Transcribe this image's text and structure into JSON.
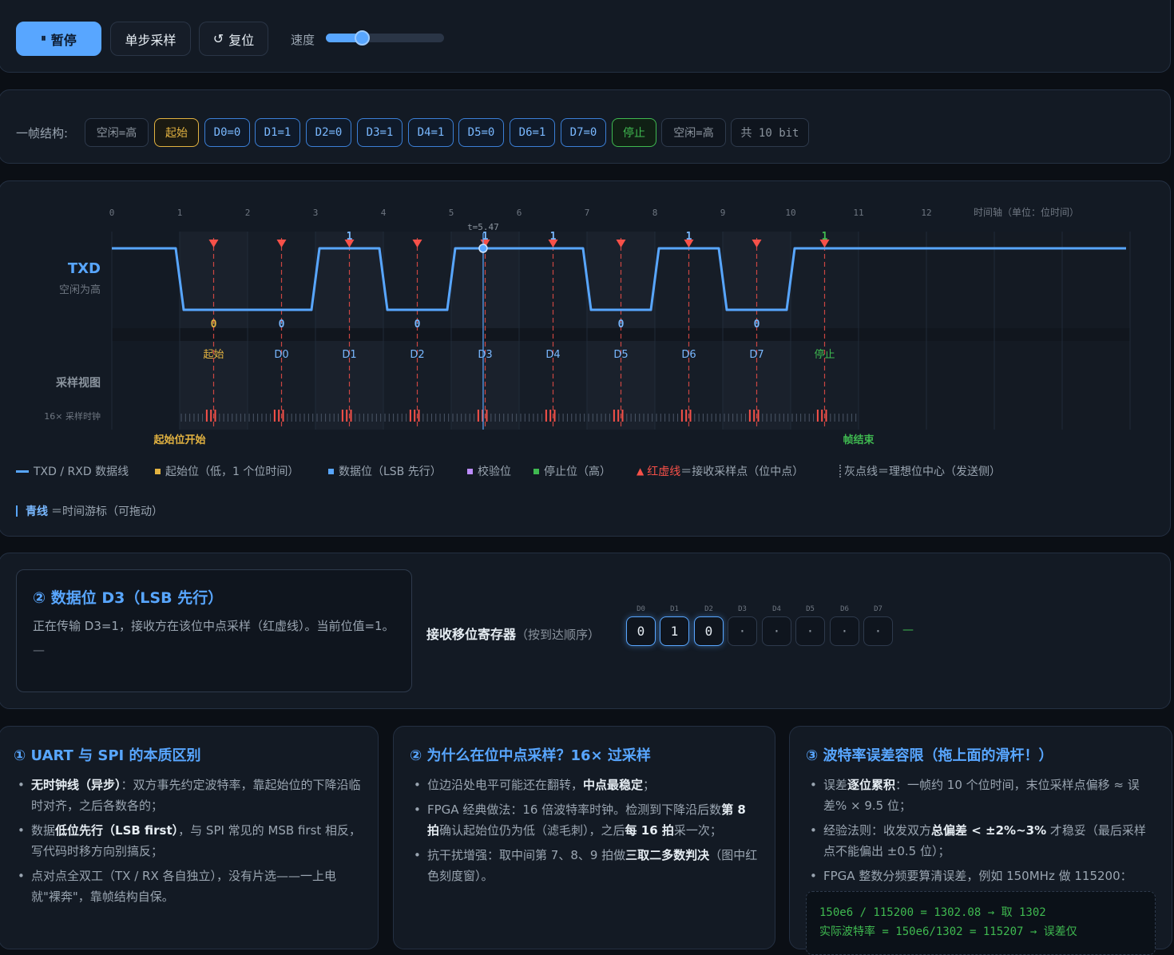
{
  "controls": {
    "pause_icon": "⏸",
    "pause_label": "暂停",
    "step_label": "单步采样",
    "reset_icon": "↺",
    "reset_label": "复位",
    "speed_label": "速度",
    "speed_value_fraction": 0.31
  },
  "frame": {
    "label": "一帧结构:",
    "chips": [
      "空闲=高",
      "起始",
      "D0=0",
      "D1=1",
      "D2=0",
      "D3=1",
      "D4=1",
      "D5=0",
      "D6=1",
      "D7=0",
      "停止",
      "空闲=高",
      "共 10 bit"
    ]
  },
  "waveform": {
    "axis_caption": "时间轴（单位：位时间）",
    "cursor_label": "t=5.47",
    "txd_label": "TXD",
    "txd_sub": "空闲为高",
    "sampling_label": "采样视图",
    "clock_label": "16× 采样时钟",
    "start_marker": "起始位开始",
    "end_marker": "帧结束",
    "bit_names": [
      "起始",
      "D0",
      "D1",
      "D2",
      "D3",
      "D4",
      "D5",
      "D6",
      "D7",
      "停止"
    ],
    "bit_values": [
      "0",
      "0",
      "1",
      "0",
      "1",
      "1",
      "0",
      "1",
      "0",
      "1"
    ],
    "ticks": [
      "0",
      "1",
      "2",
      "3",
      "4",
      "5",
      "6",
      "7",
      "8",
      "9",
      "10",
      "11",
      "12"
    ]
  },
  "legend": {
    "line": "TXD / RXD 数据线",
    "start": "起始位（低，1 个位时间）",
    "data": "数据位（LSB 先行）",
    "parity": "校验位",
    "stop": "停止位（高）",
    "sample_strong": "红虚线",
    "sample_rest": "＝接收采样点（位中点）",
    "ideal": "灰点线＝理想位中心（发送侧）",
    "cursor_strong": "青线",
    "cursor_rest": "＝时间游标（可拖动）"
  },
  "status": {
    "title": "② 数据位 D3（LSB 先行）",
    "text": "正在传输 D3=1，接收方在该位中点采样（红虚线）。当前位值=1。",
    "dash": "—",
    "register_strong": "接收移位寄存器",
    "register_rest": "（按到达顺序）",
    "register_labels": [
      "D0",
      "D1",
      "D2",
      "D3",
      "D4",
      "D5",
      "D6",
      "D7"
    ],
    "register_values": [
      "0",
      "1",
      "0",
      "·",
      "·",
      "·",
      "·",
      "·"
    ],
    "register_tail": "—"
  },
  "info": [
    {
      "title": "① UART 与 SPI 的本质区别",
      "items": [
        [
          "无时钟线（异步）",
          "：双方事先约定波特率，靠起始位的下降沿临时对齐，之后各数各的；"
        ],
        [
          "数据",
          "低位先行（LSB first）",
          "，与 SPI 常见的 MSB first 相反，写代码时移方向别搞反；"
        ],
        [
          "点对点全双工（TX / RX 各自独立），没有片选——一上电就\"裸奔\"，靠帧结构自保。"
        ]
      ]
    },
    {
      "title": "② 为什么在位中点采样？16× 过采样",
      "items": [
        [
          "位边沿处电平可能还在翻转，",
          "中点最稳定",
          "；"
        ],
        [
          "FPGA 经典做法：16 倍波特率时钟。检测到下降沿后数",
          "第 8 拍",
          "确认起始位仍为低（滤毛刺），之后",
          "每 16 拍",
          "采一次；"
        ],
        [
          "抗干扰增强：取中间第 7、8、9 拍做",
          "三取二多数判决",
          "（图中红色刻度窗）。"
        ]
      ]
    },
    {
      "title": "③ 波特率误差容限（拖上面的滑杆！）",
      "items": [
        [
          "误差",
          "逐位累积",
          "：一帧约 10 个位时间，末位采样点偏移 ≈ 误差% × 9.5 位；"
        ],
        [
          "经验法则：收发双方",
          "总偏差 < ±2%~3%",
          " 才稳妥（最后采样点不能偏出 ±0.5 位）；"
        ],
        [
          "FPGA 整数分频要算清误差，例如 150MHz 做 115200："
        ]
      ],
      "code": [
        "150e6 / 115200 = 1302.08 → 取 1302",
        "实际波特率 = 150e6/1302 = 115207 → 误差仅"
      ]
    }
  ],
  "colors": {
    "accent": "#58a6ff",
    "start": "#e3b341",
    "stop": "#3fb950",
    "sample": "#f85149",
    "parity": "#bc8cff"
  }
}
